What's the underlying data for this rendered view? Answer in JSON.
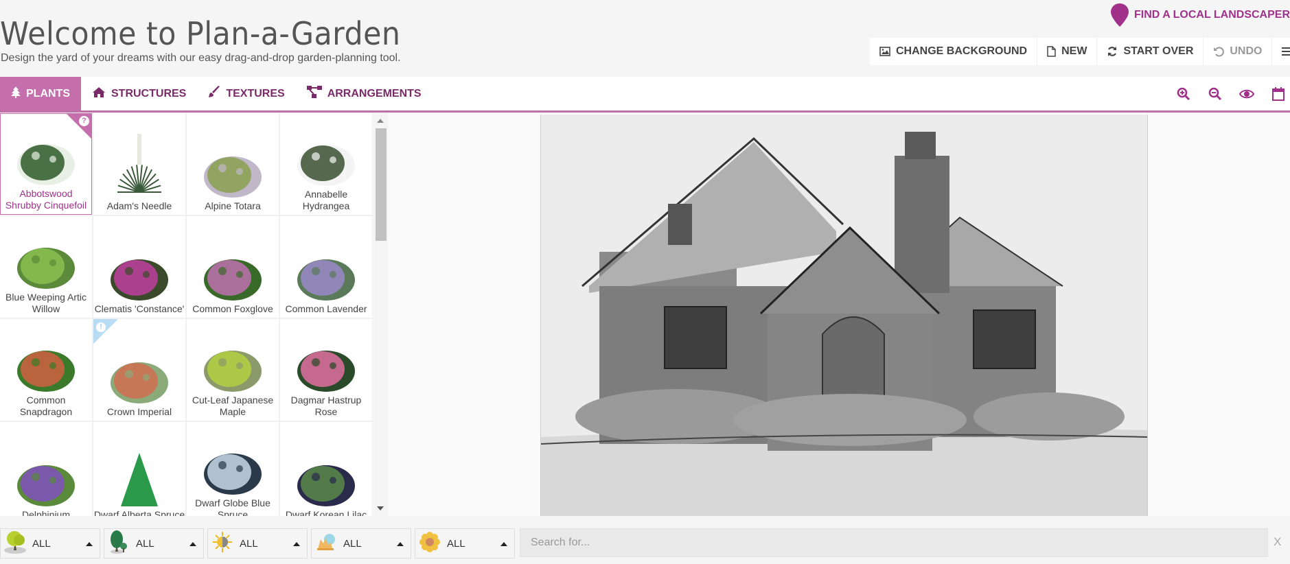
{
  "header": {
    "title": "Welcome to Plan-a-Garden",
    "subtitle": "Design the yard of your dreams with our easy drag-and-drop garden-planning tool.",
    "find_landscaper": "FIND A LOCAL LANDSCAPER"
  },
  "toolbar": {
    "change_background": "CHANGE BACKGROUND",
    "new": "NEW",
    "start_over": "START OVER",
    "undo": "UNDO"
  },
  "tabs": [
    {
      "label": "PLANTS",
      "icon": "tree-icon",
      "active": true
    },
    {
      "label": "STRUCTURES",
      "icon": "home-icon",
      "active": false
    },
    {
      "label": "TEXTURES",
      "icon": "brush-icon",
      "active": false
    },
    {
      "label": "ARRANGEMENTS",
      "icon": "sitemap-icon",
      "active": false
    }
  ],
  "tools": [
    "zoom-in-icon",
    "zoom-out-icon",
    "eye-icon",
    "calendar-icon"
  ],
  "plants": [
    {
      "name": "Abbotswood Shrubby Cinquefoil",
      "selected": true,
      "badge": "?"
    },
    {
      "name": "Adam's Needle"
    },
    {
      "name": "Alpine Totara"
    },
    {
      "name": "Annabelle Hydrangea"
    },
    {
      "name": "Blue Weeping Artic Willow"
    },
    {
      "name": "Clematis 'Constance'"
    },
    {
      "name": "Common Foxglove"
    },
    {
      "name": "Common Lavender"
    },
    {
      "name": "Common Snapdragon"
    },
    {
      "name": "Crown Imperial",
      "badge": "!"
    },
    {
      "name": "Cut-Leaf Japanese Maple"
    },
    {
      "name": "Dagmar Hastrup Rose"
    },
    {
      "name": "Delphinium"
    },
    {
      "name": "Dwarf Alberta Spruce"
    },
    {
      "name": "Dwarf Globe Blue Spruce"
    },
    {
      "name": "Dwarf Korean Lilac"
    }
  ],
  "filters": [
    {
      "icon": "deciduous-tree-icon",
      "value": "ALL"
    },
    {
      "icon": "evergreen-tree-icon",
      "value": "ALL"
    },
    {
      "icon": "sun-shade-icon",
      "value": "ALL"
    },
    {
      "icon": "season-icon",
      "value": "ALL"
    },
    {
      "icon": "flower-icon",
      "value": "ALL"
    }
  ],
  "search": {
    "placeholder": "Search for...",
    "value": "",
    "clear": "X"
  },
  "colors": {
    "accent": "#c46fac",
    "accent_dark": "#a0308a",
    "tab_text": "#7a2a68"
  }
}
